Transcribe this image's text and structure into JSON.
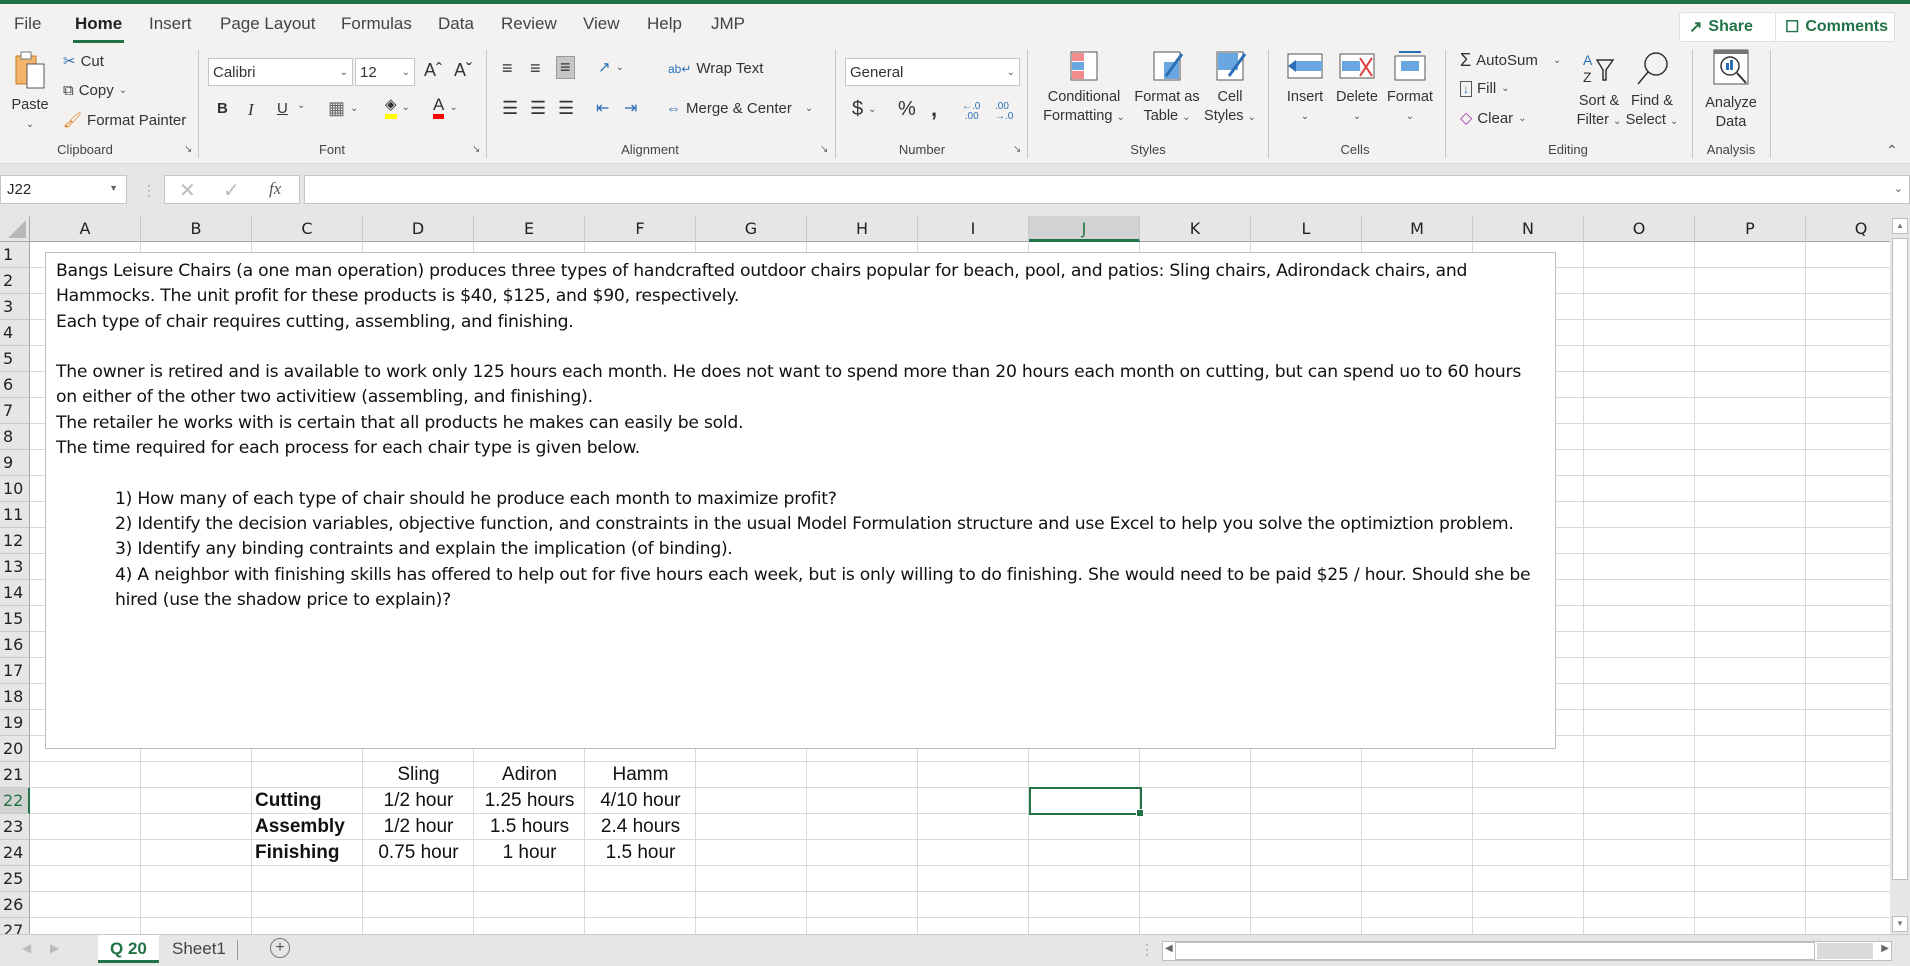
{
  "menu": {
    "tabs": [
      "File",
      "Home",
      "Insert",
      "Page Layout",
      "Formulas",
      "Data",
      "Review",
      "View",
      "Help",
      "JMP"
    ],
    "active_tab": "Home",
    "share_label": "Share",
    "comments_label": "Comments"
  },
  "ribbon": {
    "clipboard": {
      "label": "Clipboard",
      "paste": "Paste",
      "cut": "Cut",
      "copy": "Copy",
      "format_painter": "Format Painter"
    },
    "font": {
      "label": "Font",
      "font_name": "Calibri",
      "font_size": "12",
      "bold": "B",
      "italic": "I",
      "underline": "U",
      "grow": "Aˆ",
      "shrink": "Aˇ",
      "highlight_color": "#ffff00",
      "font_color": "#ff0000"
    },
    "alignment": {
      "label": "Alignment",
      "wrap_text": "Wrap Text",
      "merge_center": "Merge & Center"
    },
    "number": {
      "label": "Number",
      "format": "General",
      "currency": "$",
      "percent": "%",
      "comma": ")",
      "inc_decimal": "←.0 .00",
      "dec_decimal": ".00 →.0"
    },
    "styles": {
      "label": "Styles",
      "conditional_formatting": [
        "Conditional",
        "Formatting"
      ],
      "format_as_table": [
        "Format as",
        "Table"
      ],
      "cell_styles": [
        "Cell",
        "Styles"
      ]
    },
    "cells": {
      "label": "Cells",
      "insert": "Insert",
      "delete": "Delete",
      "format": "Format"
    },
    "editing": {
      "label": "Editing",
      "autosum": "AutoSum",
      "fill": "Fill",
      "clear": "Clear",
      "sort_filter": [
        "Sort &",
        "Filter"
      ],
      "find_select": [
        "Find &",
        "Select"
      ]
    },
    "analysis": {
      "label": "Analysis",
      "analyze_data": [
        "Analyze",
        "Data"
      ]
    }
  },
  "formula_bar": {
    "name_box": "J22",
    "fx": "fx",
    "formula": ""
  },
  "grid": {
    "columns": [
      "A",
      "B",
      "C",
      "D",
      "E",
      "F",
      "G",
      "H",
      "I",
      "J",
      "K",
      "L",
      "M",
      "N",
      "O",
      "P",
      "Q"
    ],
    "selected_column": "J",
    "rows": [
      "1",
      "2",
      "3",
      "4",
      "5",
      "6",
      "7",
      "8",
      "9",
      "10",
      "11",
      "12",
      "13",
      "14",
      "15",
      "16",
      "17",
      "18",
      "19",
      "20",
      "21",
      "22",
      "23",
      "24",
      "25",
      "26",
      "27"
    ],
    "selected_row": "22",
    "selected_cell": "J22"
  },
  "textbox": {
    "paragraphs": [
      "Bangs Leisure Chairs (a one man operation) produces three types of handcrafted outdoor chairs popular for beach, pool, and patios:  Sling chairs, Adirondack chairs, and Hammocks. The unit profit for these products is $40, $125, and $90, respectively.",
      "Each type of chair requires cutting, assembling, and finishing.",
      "",
      "The owner is retired and is available to work only 125 hours each month. He does not want to spend more than 20 hours each month on cutting, but can spend uo to 60 hours on either of the other two activitiew (assembling, and finishing).",
      "The retailer he works with is certain that all products he makes can easily be sold.",
      "The time required for each process for each chair type is given below.",
      ""
    ],
    "questions": [
      "1)  How many of each type of chair should he produce each month to maximize profit?",
      "2)  Identify the decision variables, objective function, and constraints in the usual Model Formulation structure and use Excel to help you solve the optimiztion problem.",
      "3)  Identify any binding contraints and explain the implication (of binding).",
      "4)  A neighbor with finishing skills has offered to help out for five hours each week, but is only willing to do finishing.  She would need to be paid $25 / hour.  Should she be hired (use the shadow price to explain)?"
    ]
  },
  "table": {
    "headers": [
      "Sling",
      "Adiron",
      "Hamm"
    ],
    "rows": [
      {
        "label": "Cutting",
        "values": [
          "1/2 hour",
          "1.25 hours",
          "4/10 hour"
        ]
      },
      {
        "label": "Assembly",
        "values": [
          "1/2 hour",
          "1.5 hours",
          "2.4 hours"
        ]
      },
      {
        "label": "Finishing",
        "values": [
          "0.75 hour",
          "1 hour",
          "1.5 hour"
        ]
      }
    ]
  },
  "sheets": {
    "tabs": [
      "Q 20",
      "Sheet1"
    ],
    "active": "Q 20"
  },
  "colors": {
    "accent": "#217346"
  }
}
